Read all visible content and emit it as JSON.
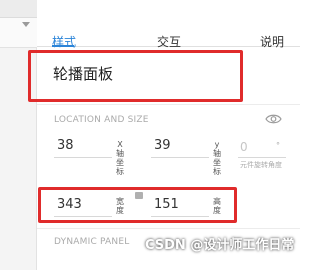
{
  "tabs": [
    {
      "label": "样式",
      "active": true
    },
    {
      "label": "交互",
      "active": false
    },
    {
      "label": "说明",
      "active": false
    }
  ],
  "widget_name": "轮播面板",
  "location_size": {
    "title": "LOCATION AND SIZE",
    "x": {
      "value": "38",
      "label": "X轴坐标"
    },
    "y": {
      "value": "39",
      "label": "y轴坐标"
    },
    "rotation": {
      "value": "0",
      "unit": "°",
      "label": "元件旋转角度"
    },
    "width": {
      "value": "343",
      "label": "宽度"
    },
    "height": {
      "value": "151",
      "label": "高度"
    }
  },
  "dynamic_panel_title": "DYNAMIC PANEL",
  "watermark": "CSDN @设计师工作日常",
  "colors": {
    "accent": "#2b84d8",
    "highlight": "#e02b2b"
  }
}
